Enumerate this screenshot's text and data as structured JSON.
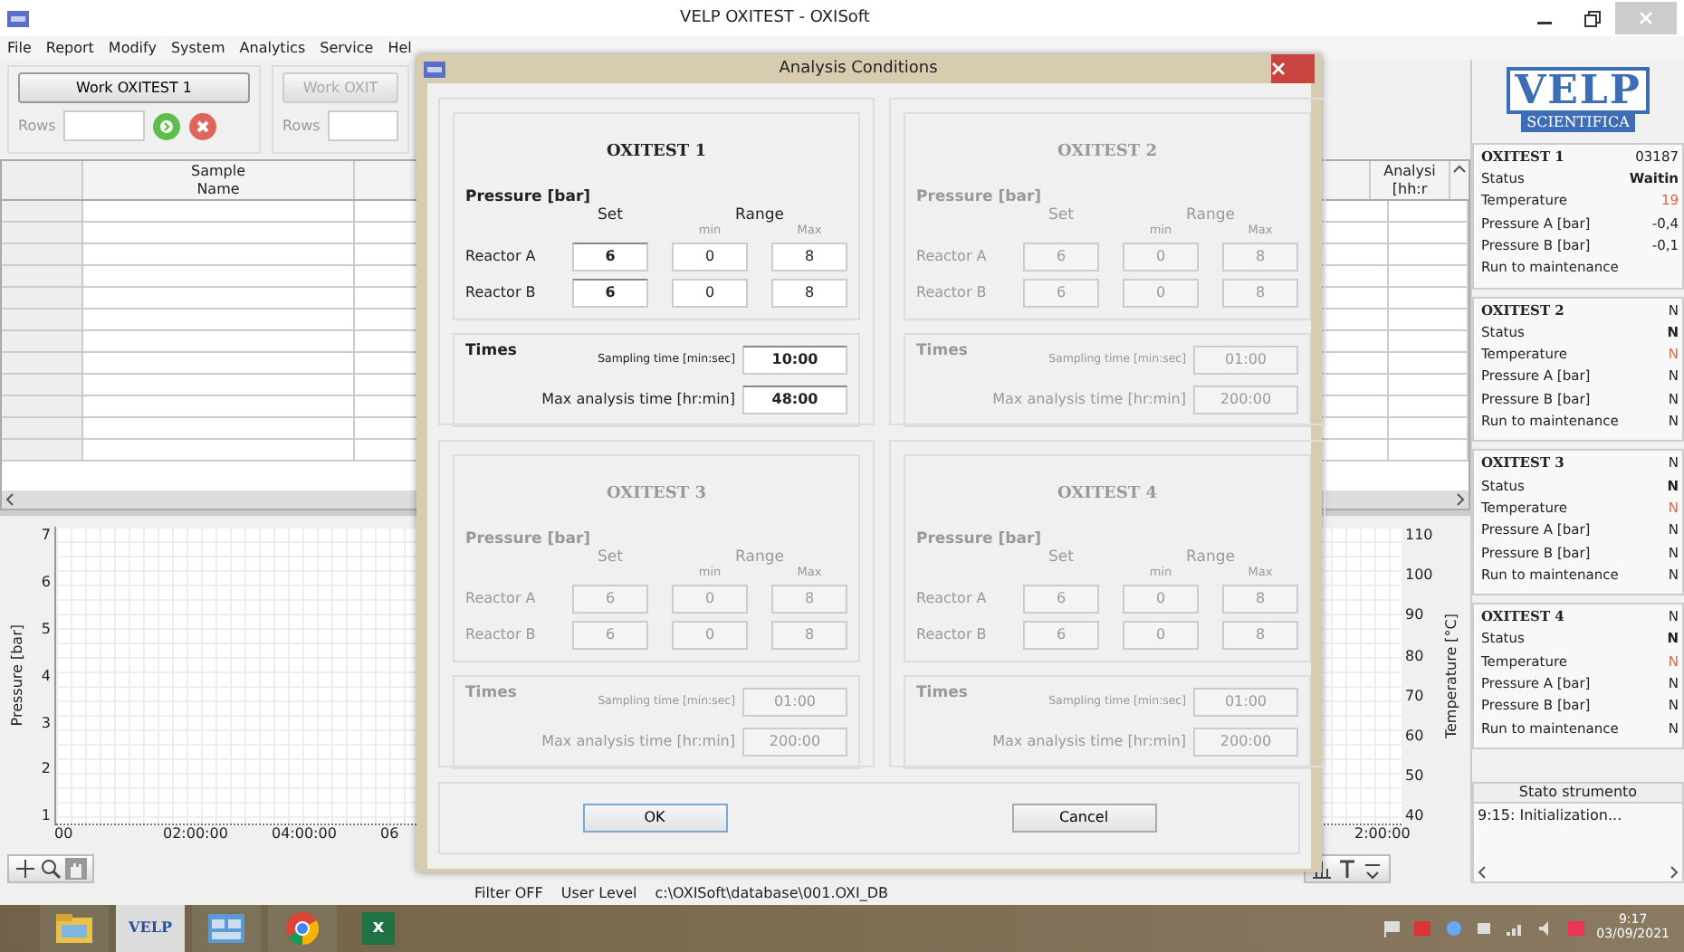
{
  "window": {
    "title": "VELP OXITEST - OXISoft"
  },
  "menu": [
    "File",
    "Report",
    "Modify",
    "System",
    "Analytics",
    "Service",
    "Hel"
  ],
  "work_groups": [
    {
      "button": "Work OXITEST 1",
      "rows_label": "Rows",
      "enabled": true,
      "actions": true
    },
    {
      "button": "Work OXIT",
      "rows_label": "Rows",
      "enabled": false,
      "actions": false
    }
  ],
  "table": {
    "columns": [
      "Sample Name",
      "Analysi [hh:r"
    ]
  },
  "chart": {
    "ylabel": "Pressure [bar]",
    "yticks": [
      "7",
      "6",
      "5",
      "4",
      "3",
      "2",
      "1"
    ],
    "xticks": [
      "00",
      "02:00:00",
      "04:00:00",
      "06"
    ],
    "y2label": "Temperature [°C]",
    "y2ticks": [
      "110",
      "100",
      "90",
      "80",
      "70",
      "60",
      "50",
      "40"
    ],
    "end_label": "2:00:00"
  },
  "logo": {
    "name": "VELP",
    "tagline": "SCIENTIFICA"
  },
  "instruments": [
    {
      "title": "OXITEST 1",
      "code": "03187",
      "rows": [
        {
          "label": "Status",
          "value": "Waitin",
          "kind": "status"
        },
        {
          "label": "Temperature",
          "value": "19",
          "kind": "temperature"
        },
        {
          "label": "Pressure A [bar]",
          "value": "-0,4",
          "kind": "plain"
        },
        {
          "label": "Pressure B [bar]",
          "value": "-0,1",
          "kind": "plain"
        },
        {
          "label": "Run to maintenance",
          "kind": "plain"
        }
      ]
    },
    {
      "title": "OXITEST 2",
      "code": "N",
      "rows": [
        {
          "label": "Status",
          "value": "N",
          "kind": "status"
        },
        {
          "label": "Temperature",
          "value": "N",
          "kind": "temperature"
        },
        {
          "label": "Pressure A [bar]",
          "value": "N",
          "kind": "plain"
        },
        {
          "label": "Pressure B [bar]",
          "value": "N",
          "kind": "plain"
        },
        {
          "label": "Run to maintenance",
          "value": "N",
          "kind": "plain"
        }
      ]
    },
    {
      "title": "OXITEST 3",
      "code": "N",
      "rows": [
        {
          "label": "Status",
          "value": "N",
          "kind": "status"
        },
        {
          "label": "Temperature",
          "value": "N",
          "kind": "temperature"
        },
        {
          "label": "Pressure A [bar]",
          "value": "N",
          "kind": "plain"
        },
        {
          "label": "Pressure B [bar]",
          "value": "N",
          "kind": "plain"
        },
        {
          "label": "Run to maintenance",
          "value": "N",
          "kind": "plain"
        }
      ]
    },
    {
      "title": "OXITEST 4",
      "code": "N",
      "rows": [
        {
          "label": "Status",
          "value": "N",
          "kind": "status"
        },
        {
          "label": "Temperature",
          "value": "N",
          "kind": "temperature"
        },
        {
          "label": "Pressure A [bar]",
          "value": "N",
          "kind": "plain"
        },
        {
          "label": "Pressure B [bar]",
          "value": "N",
          "kind": "plain"
        },
        {
          "label": "Run to maintenance",
          "value": "N",
          "kind": "plain"
        }
      ]
    }
  ],
  "instrument_log": {
    "title": "Stato strumento",
    "lines": [
      "9:15: Initialization..."
    ]
  },
  "status_bar": [
    "Filter OFF",
    "User Level",
    "c:\\OXISoft\\database\\001.OXI_DB"
  ],
  "dialog": {
    "title": "Analysis Conditions",
    "panels": [
      {
        "title": "OXITEST 1",
        "enabled": true,
        "pressure_label": "Pressure [bar]",
        "set_label": "Set",
        "range_label": "Range",
        "min_label": "min",
        "max_label": "Max",
        "reactors": [
          {
            "label": "Reactor A",
            "set": "6",
            "min": "0",
            "max": "8"
          },
          {
            "label": "Reactor B",
            "set": "6",
            "min": "0",
            "max": "8"
          }
        ],
        "times_label": "Times",
        "sampling_label": "Sampling time [min:sec]",
        "sampling": "10:00",
        "max_time_label": "Max analysis time [hr:min]",
        "max_time": "48:00"
      },
      {
        "title": "OXITEST 2",
        "enabled": false,
        "pressure_label": "Pressure [bar]",
        "set_label": "Set",
        "range_label": "Range",
        "min_label": "min",
        "max_label": "Max",
        "reactors": [
          {
            "label": "Reactor A",
            "set": "6",
            "min": "0",
            "max": "8"
          },
          {
            "label": "Reactor B",
            "set": "6",
            "min": "0",
            "max": "8"
          }
        ],
        "times_label": "Times",
        "sampling_label": "Sampling time [min:sec]",
        "sampling": "01:00",
        "max_time_label": "Max analysis time [hr:min]",
        "max_time": "200:00"
      },
      {
        "title": "OXITEST 3",
        "enabled": false,
        "pressure_label": "Pressure [bar]",
        "set_label": "Set",
        "range_label": "Range",
        "min_label": "min",
        "max_label": "Max",
        "reactors": [
          {
            "label": "Reactor A",
            "set": "6",
            "min": "0",
            "max": "8"
          },
          {
            "label": "Reactor B",
            "set": "6",
            "min": "0",
            "max": "8"
          }
        ],
        "times_label": "Times",
        "sampling_label": "Sampling time [min:sec]",
        "sampling": "01:00",
        "max_time_label": "Max analysis time [hr:min]",
        "max_time": "200:00"
      },
      {
        "title": "OXITEST 4",
        "enabled": false,
        "pressure_label": "Pressure [bar]",
        "set_label": "Set",
        "range_label": "Range",
        "min_label": "min",
        "max_label": "Max",
        "reactors": [
          {
            "label": "Reactor A",
            "set": "6",
            "min": "0",
            "max": "8"
          },
          {
            "label": "Reactor B",
            "set": "6",
            "min": "0",
            "max": "8"
          }
        ],
        "times_label": "Times",
        "sampling_label": "Sampling time [min:sec]",
        "sampling": "01:00",
        "max_time_label": "Max analysis time [hr:min]",
        "max_time": "200:00"
      }
    ],
    "buttons": [
      {
        "label": "OK",
        "default": true
      },
      {
        "label": "Cancel",
        "default": false
      }
    ]
  },
  "taskbar": {
    "apps": [
      {
        "kind": "folder"
      },
      {
        "kind": "velp",
        "label": "VELP"
      },
      {
        "kind": "app"
      },
      {
        "kind": "chrome"
      },
      {
        "kind": "excel",
        "label": "x"
      }
    ],
    "time": "9:17",
    "date": "03/09/2021"
  }
}
